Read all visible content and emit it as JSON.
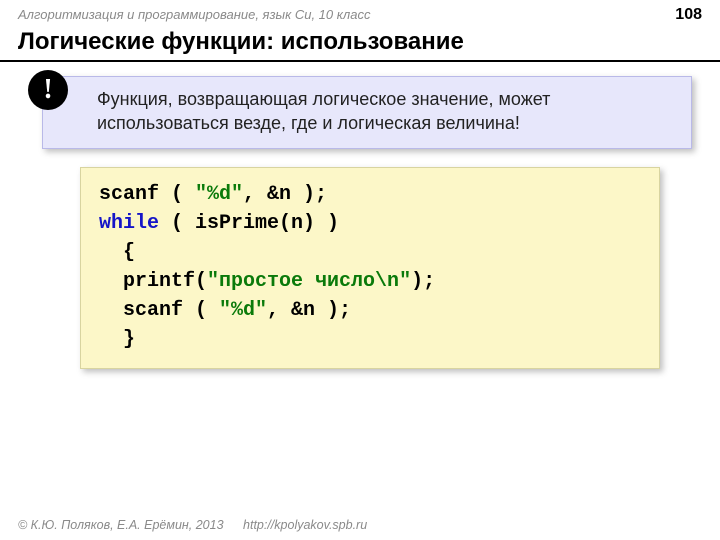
{
  "header": {
    "course": "Алгоритмизация и программирование, язык Си, 10 класс",
    "page": "108"
  },
  "title": "Логические функции: использование",
  "callout": {
    "bang": "!",
    "text": "Функция, возвращающая логическое значение, может использоваться везде, где и логическая величина!"
  },
  "code": {
    "l1a": "scanf ( ",
    "l1b": "\"%d\"",
    "l1c": ", &n );",
    "l2a": "while",
    "l2b": " ( isPrime(n) )",
    "l3": "  {",
    "l4a": "  printf(",
    "l4b": "\"простое число\\n\"",
    "l4c": ");",
    "l5a": "  scanf ( ",
    "l5b": "\"%d\"",
    "l5c": ", &n );",
    "l6": "  }"
  },
  "footer": {
    "copyright": "© К.Ю. Поляков, Е.А. Ерёмин, 2013",
    "url": "http://kpolyakov.spb.ru"
  }
}
